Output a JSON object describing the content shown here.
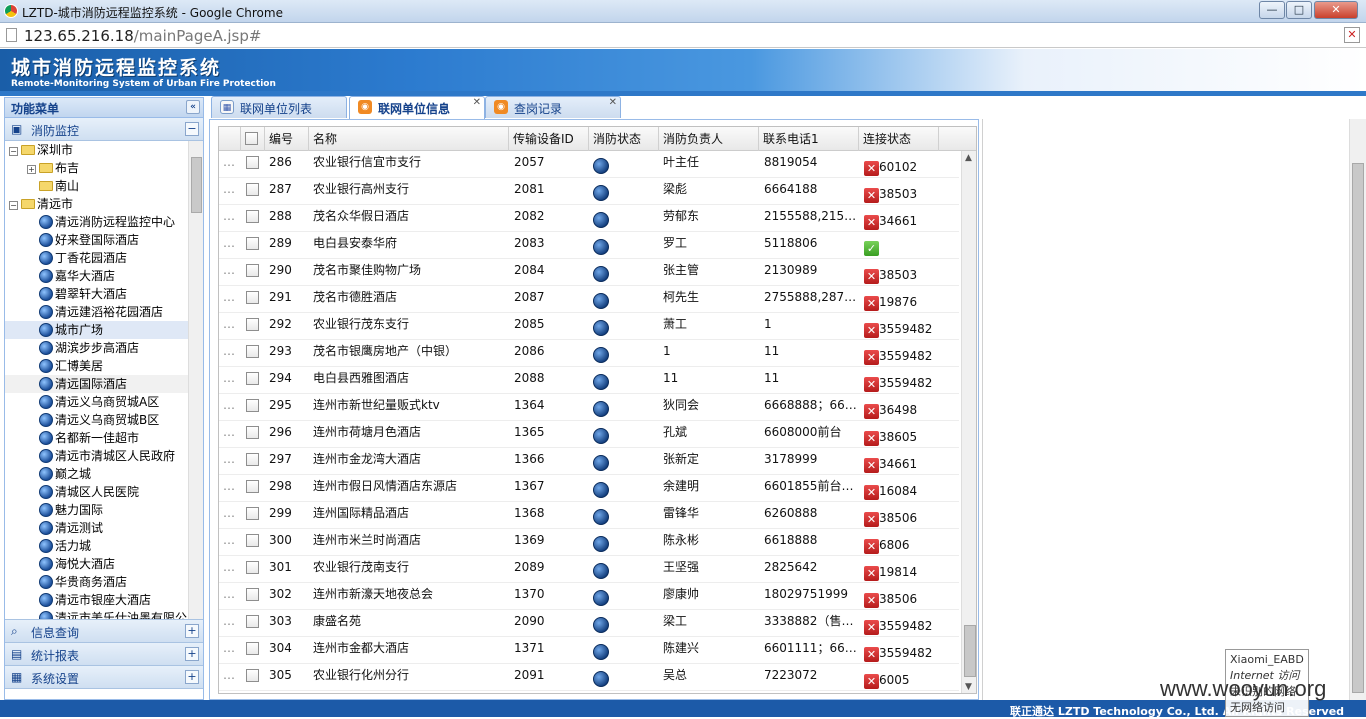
{
  "window": {
    "title": "LZTD-城市消防远程监控系统 - Google Chrome",
    "min": "—",
    "max": "□",
    "close": "✕"
  },
  "address": {
    "host": "123.65.216.18",
    "path": "/mainPageA.jsp#"
  },
  "banner": {
    "title_cn": "城市消防远程监控系统",
    "title_en": "Remote-Monitoring System of Urban Fire Protection"
  },
  "sidebar": {
    "header": "功能菜单",
    "collapse": "«",
    "panels": [
      {
        "label": "消防监控",
        "tool": "−",
        "icon": "monitor-icon"
      },
      {
        "label": "信息查询",
        "tool": "+",
        "icon": "search-icon"
      },
      {
        "label": "统计报表",
        "tool": "+",
        "icon": "report-icon"
      },
      {
        "label": "系统设置",
        "tool": "+",
        "icon": "settings-icon"
      }
    ],
    "tree": [
      "深圳市",
      "布吉",
      "南山",
      "清远市",
      "清远消防远程监控中心",
      "好来登国际酒店",
      "丁香花园酒店",
      "嘉华大酒店",
      "碧翠轩大酒店",
      "清远建滔裕花园酒店",
      "城市广场",
      "湖滨步步高酒店",
      "汇博美居",
      "清远国际酒店",
      "清远义乌商贸城A区",
      "清远义乌商贸城B区",
      "名都新一佳超市",
      "清远市清城区人民政府",
      "巅之城",
      "清城区人民医院",
      "魅力国际",
      "清远测试",
      "活力城",
      "海悦大酒店",
      "华贵商务酒店",
      "清远市银座大酒店",
      "清远市美乐仕油墨有限公"
    ]
  },
  "tabs": [
    {
      "label": "联网单位列表",
      "icon": "grid-icon",
      "close": "✕"
    },
    {
      "label": "联网单位信息",
      "icon": "rss-icon",
      "close": "✕"
    },
    {
      "label": "查岗记录",
      "icon": "rss-icon",
      "close": "✕"
    }
  ],
  "grid": {
    "columns": [
      "编号",
      "名称",
      "传输设备ID",
      "消防状态",
      "消防负责人",
      "联系电话1",
      "连接状态"
    ],
    "rows": [
      {
        "id": "286",
        "name": "农业银行信宜市支行",
        "dev": "2057",
        "person": "叶主任",
        "phone": "8819054",
        "conn": "error",
        "conn_text": "60102"
      },
      {
        "id": "287",
        "name": "农业银行高州支行",
        "dev": "2081",
        "person": "梁彪",
        "phone": "6664188",
        "conn": "error",
        "conn_text": "38503"
      },
      {
        "id": "288",
        "name": "茂名众华假日酒店",
        "dev": "2082",
        "person": "劳郁东",
        "phone": "2155588,215…",
        "conn": "error",
        "conn_text": "34661"
      },
      {
        "id": "289",
        "name": "电白县安泰华府",
        "dev": "2083",
        "person": "罗工",
        "phone": "5118806",
        "conn": "ok",
        "conn_text": ""
      },
      {
        "id": "290",
        "name": "茂名市聚佳购物广场",
        "dev": "2084",
        "person": "张主管",
        "phone": "2130989",
        "conn": "error",
        "conn_text": "38503"
      },
      {
        "id": "291",
        "name": "茂名市德胜酒店",
        "dev": "2087",
        "person": "柯先生",
        "phone": "2755888,287…",
        "conn": "error",
        "conn_text": "19876"
      },
      {
        "id": "292",
        "name": "农业银行茂东支行",
        "dev": "2085",
        "person": "萧工",
        "phone": "1",
        "conn": "error",
        "conn_text": "3559482"
      },
      {
        "id": "293",
        "name": "茂名市银鹰房地产（中银）",
        "dev": "2086",
        "person": "1",
        "phone": "11",
        "conn": "error",
        "conn_text": "3559482"
      },
      {
        "id": "294",
        "name": "电白县西雅图酒店",
        "dev": "2088",
        "person": "11",
        "phone": "11",
        "conn": "error",
        "conn_text": "3559482"
      },
      {
        "id": "295",
        "name": "连州市新世纪量贩式ktv",
        "dev": "1364",
        "person": "狄同会",
        "phone": "6668888；66…",
        "conn": "error",
        "conn_text": "36498"
      },
      {
        "id": "296",
        "name": "连州市荷塘月色酒店",
        "dev": "1365",
        "person": "孔斌",
        "phone": "6608000前台",
        "conn": "error",
        "conn_text": "38605"
      },
      {
        "id": "297",
        "name": "连州市金龙湾大酒店",
        "dev": "1366",
        "person": "张新定",
        "phone": "3178999",
        "conn": "error",
        "conn_text": "34661"
      },
      {
        "id": "298",
        "name": "连州市假日风情酒店东源店",
        "dev": "1367",
        "person": "余建明",
        "phone": "6601855前台…",
        "conn": "error",
        "conn_text": "16084"
      },
      {
        "id": "299",
        "name": "连州国际精品酒店",
        "dev": "1368",
        "person": "雷锋华",
        "phone": "6260888",
        "conn": "error",
        "conn_text": "38506"
      },
      {
        "id": "300",
        "name": "连州市米兰时尚酒店",
        "dev": "1369",
        "person": "陈永彬",
        "phone": "6618888",
        "conn": "error",
        "conn_text": "6806"
      },
      {
        "id": "301",
        "name": "农业银行茂南支行",
        "dev": "2089",
        "person": "王坚强",
        "phone": "2825642",
        "conn": "error",
        "conn_text": "19814"
      },
      {
        "id": "302",
        "name": "连州市新濠天地夜总会",
        "dev": "1370",
        "person": "廖康帅",
        "phone": "18029751999",
        "conn": "error",
        "conn_text": "38506"
      },
      {
        "id": "303",
        "name": "康盛名苑",
        "dev": "2090",
        "person": "梁工",
        "phone": "3338882（售…",
        "conn": "error",
        "conn_text": "3559482"
      },
      {
        "id": "304",
        "name": "连州市金都大酒店",
        "dev": "1371",
        "person": "陈建兴",
        "phone": "6601111；66…",
        "conn": "error",
        "conn_text": "3559482"
      },
      {
        "id": "305",
        "name": "农业银行化州分行",
        "dev": "2091",
        "person": "吴总",
        "phone": "7223072",
        "conn": "error",
        "conn_text": "6005"
      }
    ]
  },
  "footer": {
    "text": "联正通达 LZTD Technology Co., Ltd.  All Rights Reserved"
  },
  "overlay": {
    "watermark": "www.wooyun.org",
    "wifi_name": "Xiaomi_EABD",
    "wifi_status": "Internet 访问",
    "wifi_line3": "未识别的网络",
    "wifi_line4": "无网络访问"
  }
}
